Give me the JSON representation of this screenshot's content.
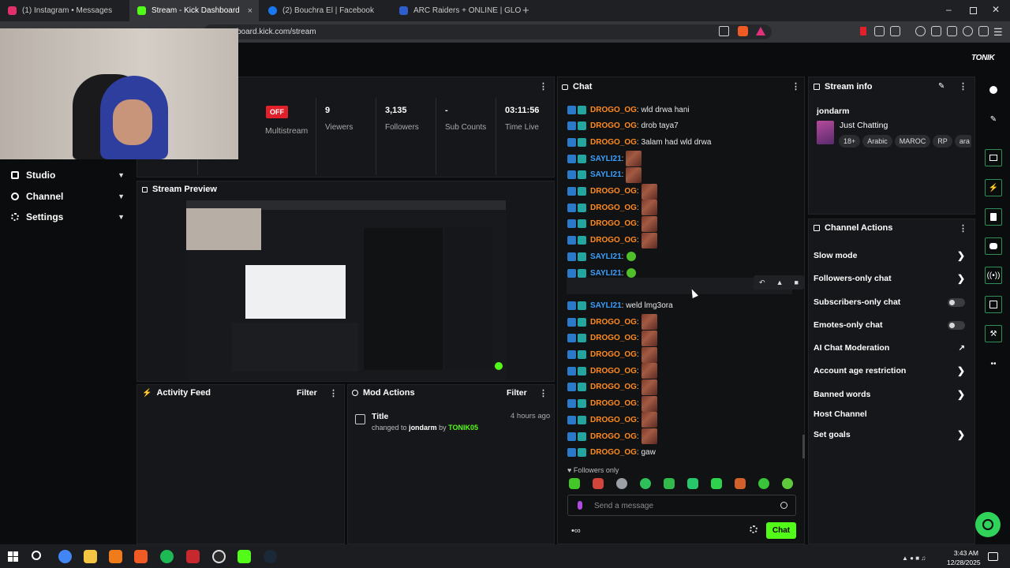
{
  "browser": {
    "tabs": [
      {
        "label": "(1) Instagram • Messages",
        "color": "#e1306c"
      },
      {
        "label": "Stream - Kick Dashboard",
        "color": "#53fc18"
      },
      {
        "label": "(2) Bouchra El | Facebook",
        "color": "#1877f2"
      },
      {
        "label": "ARC Raiders + ONLINE | GLOBAL | AI",
        "color": "#2d5ec9"
      }
    ],
    "url": "board.kick.com/stream",
    "new_tab": "+",
    "close_tab": "×"
  },
  "brand": "TONIK",
  "sidebar": {
    "items": [
      {
        "label": "Studio",
        "icon": "studio-icon"
      },
      {
        "label": "Channel",
        "icon": "channel-icon"
      },
      {
        "label": "Settings",
        "icon": "gear-icon"
      }
    ]
  },
  "stats": {
    "off_badge": "OFF",
    "multistream": "Multistream",
    "viewers_value": "9",
    "viewers_label": "Viewers",
    "followers_value": "3,135",
    "followers_label": "Followers",
    "subs_value": "-",
    "subs_label": "Sub Counts",
    "time_value": "03:11:56",
    "time_label": "Time Live"
  },
  "preview": {
    "title": "Stream Preview"
  },
  "activity": {
    "title": "Activity Feed",
    "filter": "Filter"
  },
  "mod_actions": {
    "title": "Mod Actions",
    "filter": "Filter",
    "entry": {
      "title": "Title",
      "time": "4 hours ago",
      "pre": "changed to",
      "value": "jondarm",
      "by": "by",
      "actor": "TONIK05"
    }
  },
  "chat": {
    "title": "Chat",
    "messages": [
      {
        "user": "DROGO_OG",
        "text": ": wld drwa hani",
        "emote": "",
        "color": "#ff8a1f"
      },
      {
        "user": "DROGO_OG",
        "text": ": drob taya7",
        "emote": "",
        "color": "#ff8a1f"
      },
      {
        "user": "DROGO_OG",
        "text": ": 3alam had wld drwa",
        "emote": "",
        "color": "#ff8a1f"
      },
      {
        "user": "SAYLI21",
        "text": ":",
        "emote": "img",
        "color": "#3aa0ff"
      },
      {
        "user": "SAYLI21",
        "text": ":",
        "emote": "img",
        "color": "#3aa0ff"
      },
      {
        "user": "DROGO_OG",
        "text": ":",
        "emote": "img",
        "color": "#ff8a1f"
      },
      {
        "user": "DROGO_OG",
        "text": ":",
        "emote": "img",
        "color": "#ff8a1f"
      },
      {
        "user": "DROGO_OG",
        "text": ":",
        "emote": "img",
        "color": "#ff8a1f"
      },
      {
        "user": "DROGO_OG",
        "text": ":",
        "emote": "img",
        "color": "#ff8a1f"
      },
      {
        "user": "SAYLI21",
        "text": ":",
        "emote": "green",
        "color": "#3aa0ff"
      },
      {
        "user": "SAYLI21",
        "text": ":",
        "emote": "green",
        "color": "#3aa0ff"
      },
      {
        "user": "SAYLI21",
        "text": ":",
        "emote": "pill",
        "color": "#3aa0ff"
      },
      {
        "user": "SAYLI21",
        "text": ": weld lmg3ora",
        "emote": "",
        "color": "#3aa0ff"
      },
      {
        "user": "DROGO_OG",
        "text": ":",
        "emote": "img",
        "color": "#ff8a1f"
      },
      {
        "user": "DROGO_OG",
        "text": ":",
        "emote": "img",
        "color": "#ff8a1f"
      },
      {
        "user": "DROGO_OG",
        "text": ":",
        "emote": "img",
        "color": "#ff8a1f"
      },
      {
        "user": "DROGO_OG",
        "text": ":",
        "emote": "img",
        "color": "#ff8a1f"
      },
      {
        "user": "DROGO_OG",
        "text": ":",
        "emote": "img",
        "color": "#ff8a1f"
      },
      {
        "user": "DROGO_OG",
        "text": ":",
        "emote": "img",
        "color": "#ff8a1f"
      },
      {
        "user": "DROGO_OG",
        "text": ":",
        "emote": "img",
        "color": "#ff8a1f"
      },
      {
        "user": "DROGO_OG",
        "text": ":",
        "emote": "img",
        "color": "#ff8a1f"
      },
      {
        "user": "DROGO_OG",
        "text": ": gaw",
        "emote": "",
        "color": "#ff8a1f"
      }
    ],
    "followers_only": "Followers only",
    "placeholder": "Send a message",
    "send": "Chat",
    "accent": "#53fc18"
  },
  "stream_info": {
    "title": "Stream info",
    "channel": "jondarm",
    "category": "Just Chatting",
    "tags": [
      "18+",
      "Arabic",
      "MAROC",
      "RP",
      "ara"
    ]
  },
  "channel_actions": {
    "title": "Channel Actions",
    "items": [
      {
        "label": "Slow mode",
        "control": "arrow"
      },
      {
        "label": "Followers-only chat",
        "control": "arrow"
      },
      {
        "label": "Subscribers-only chat",
        "control": "toggle"
      },
      {
        "label": "Emotes-only chat",
        "control": "toggle"
      },
      {
        "label": "AI Chat Moderation",
        "control": "external"
      },
      {
        "label": "Account age restriction",
        "control": "arrow"
      },
      {
        "label": "Banned words",
        "control": "arrow"
      },
      {
        "label": "Host Channel",
        "control": "none"
      },
      {
        "label": "Set goals",
        "control": "arrow"
      }
    ]
  },
  "taskbar": {
    "time": "3:43 AM",
    "date": "12/28/2025"
  }
}
